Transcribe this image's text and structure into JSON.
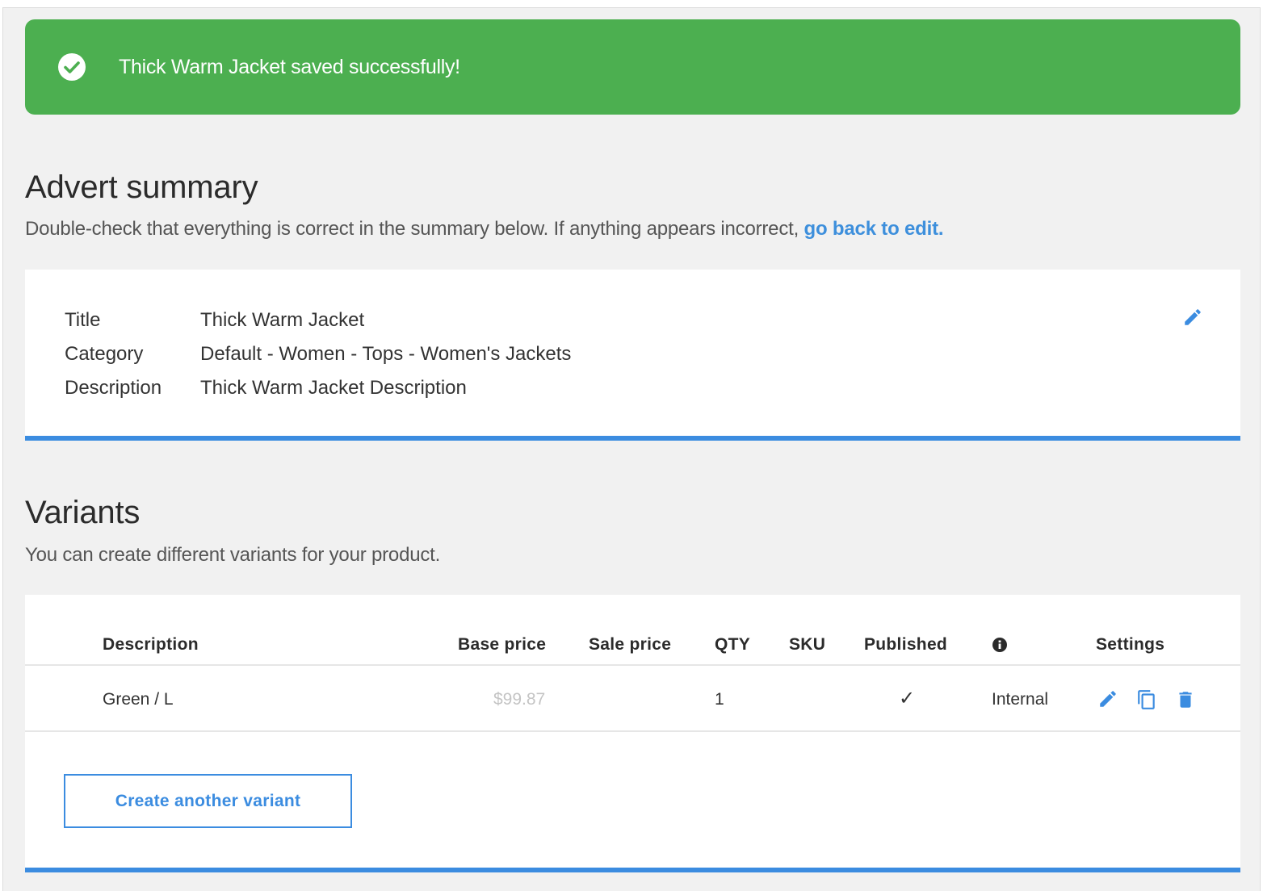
{
  "toast": {
    "message": "Thick Warm Jacket saved successfully!"
  },
  "summary": {
    "heading": "Advert summary",
    "subtitle": "Double-check that everything is correct in the summary below. If anything appears incorrect, ",
    "back_link": "go back to edit.",
    "fields": [
      {
        "label": "Title",
        "value": "Thick Warm Jacket"
      },
      {
        "label": "Category",
        "value": "Default - Women - Tops - Women's Jackets"
      },
      {
        "label": "Description",
        "value": "Thick Warm Jacket Description"
      }
    ]
  },
  "variants": {
    "heading": "Variants",
    "subtitle": "You can create different variants for your product.",
    "columns": {
      "description": "Description",
      "base_price": "Base price",
      "sale_price": "Sale price",
      "qty": "QTY",
      "sku": "SKU",
      "published": "Published",
      "settings": "Settings"
    },
    "rows": [
      {
        "description": "Green / L",
        "base_price": "$99.87",
        "sale_price": "",
        "qty": "1",
        "sku": "",
        "published": "✓",
        "visibility": "Internal"
      }
    ],
    "create_label": "Create another variant"
  },
  "colors": {
    "success": "#4caf50",
    "accent": "#3b8ce0",
    "link": "#3d8fdc",
    "background": "#f1f1f1"
  },
  "icons": [
    "check-circle-icon",
    "pencil-icon",
    "info-icon",
    "copy-icon",
    "trash-icon"
  ]
}
